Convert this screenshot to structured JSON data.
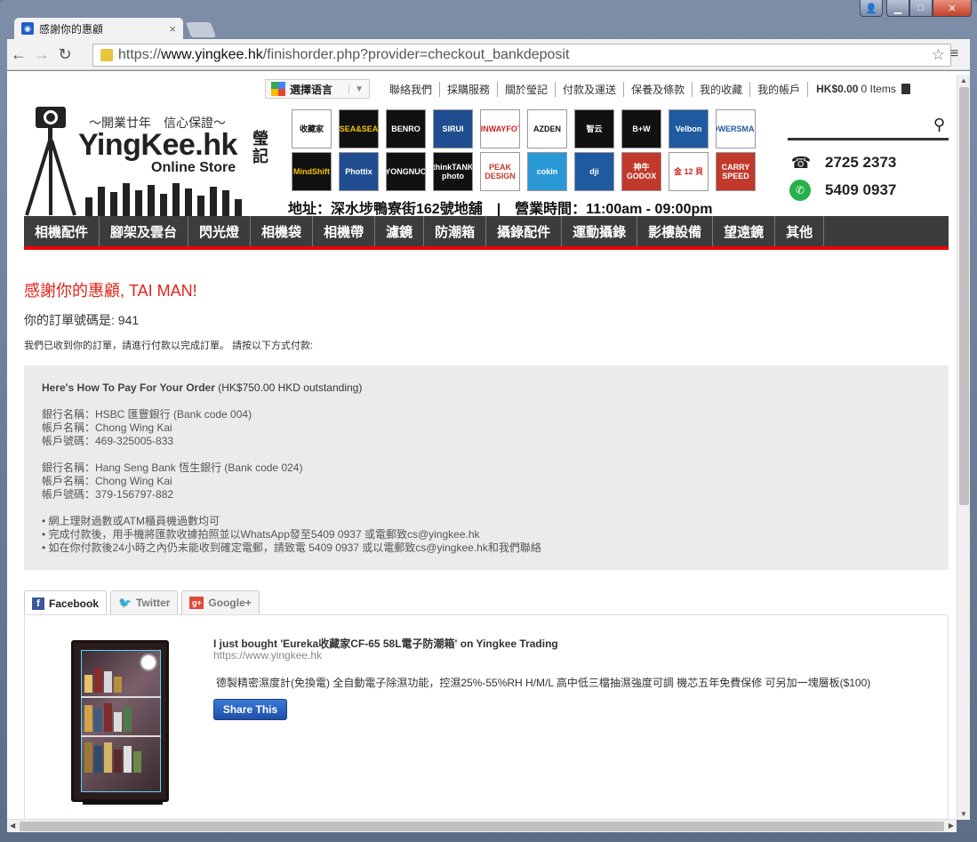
{
  "browser": {
    "tab_title": "感謝你的惠顧",
    "url_scheme": "https://",
    "url_host": "www.yingkee.hk",
    "url_path": "/finishorder.php?provider=checkout_bankdeposit"
  },
  "header": {
    "language_label": "選擇语言",
    "links": [
      "聯絡我們",
      "採購服務",
      "關於瑩記",
      "付款及運送",
      "保養及條款",
      "我的收藏",
      "我的帳戶"
    ],
    "cart_amount": "HK$0.00",
    "cart_items": "0 Items"
  },
  "logo": {
    "slogan": "～開業廿年　信心保證～",
    "name": "YingKee.hk",
    "store": "Online Store",
    "chinese": "瑩記"
  },
  "brands": [
    {
      "label": "收藏家",
      "bg": "#ffffff",
      "fg": "#111111"
    },
    {
      "label": "SEA&SEA",
      "bg": "#111111",
      "fg": "#f2c200"
    },
    {
      "label": "BENRO",
      "bg": "#111111",
      "fg": "#ffffff"
    },
    {
      "label": "SIRUI",
      "bg": "#1f4d8f",
      "fg": "#ffffff"
    },
    {
      "label": "SUNWAYFOTO",
      "bg": "#ffffff",
      "fg": "#d22222"
    },
    {
      "label": "AZDEN",
      "bg": "#ffffff",
      "fg": "#111111"
    },
    {
      "label": "智云",
      "bg": "#111111",
      "fg": "#ffffff"
    },
    {
      "label": "B+W",
      "bg": "#111111",
      "fg": "#ffffff"
    },
    {
      "label": "Velbon",
      "bg": "#1f5aa0",
      "fg": "#ffffff"
    },
    {
      "label": "POWERSMART",
      "bg": "#ffffff",
      "fg": "#1f5aa0"
    },
    {
      "label": "MindShift",
      "bg": "#111111",
      "fg": "#f2c200"
    },
    {
      "label": "Phottix",
      "bg": "#1f4d8f",
      "fg": "#ffffff"
    },
    {
      "label": "YONGNUO",
      "bg": "#111111",
      "fg": "#ffffff"
    },
    {
      "label": "thinkTANK photo",
      "bg": "#111111",
      "fg": "#ffffff"
    },
    {
      "label": "PEAK DESIGN",
      "bg": "#ffffff",
      "fg": "#c0392b"
    },
    {
      "label": "cokin",
      "bg": "#2b98d6",
      "fg": "#ffffff"
    },
    {
      "label": "dji",
      "bg": "#1f5aa0",
      "fg": "#ffffff"
    },
    {
      "label": "神牛 GODOX",
      "bg": "#c0392b",
      "fg": "#ffffff"
    },
    {
      "label": "金 12 貝",
      "bg": "#ffffff",
      "fg": "#d22222"
    },
    {
      "label": "CARRY SPEED",
      "bg": "#c0392b",
      "fg": "#ffffff"
    }
  ],
  "address": "地址：深水埗鴨寮街162號地舖　|　營業時間：11:00am - 09:00pm",
  "contact": {
    "phone": "2725 2373",
    "whatsapp": "5409 0937"
  },
  "categories": [
    "相機配件",
    "腳架及雲台",
    "閃光燈",
    "相機袋",
    "相機帶",
    "濾鏡",
    "防潮箱",
    "攝錄配件",
    "運動攝錄",
    "影樓設備",
    "望遠鏡",
    "其他"
  ],
  "main": {
    "thanks": "感謝你的惠顧, TAI MAN!",
    "order_number": "你的訂單號碼是: 941",
    "received": "我們已收到你的訂單，請進行付款以完成訂單。 請按以下方式付款:",
    "howto_bold": "Here's How To Pay For Your Order",
    "howto_amount": " (HK$750.00 HKD outstanding)",
    "bank1": [
      "銀行名稱：HSBC 匯豐銀行 (Bank code 004)",
      "帳戶名稱：Chong Wing Kai",
      "帳戶號碼：469-325005-833"
    ],
    "bank2": [
      "銀行名稱：Hang Seng Bank 恆生銀行 (Bank code 024)",
      "帳戶名稱：Chong Wing Kai",
      "帳戶號碼：379-156797-882"
    ],
    "notes": [
      "• 網上理財過數或ATM櫃員機過數均可",
      "• 完成付款後，用手機將匯款收據拍照並以WhatsApp發至5409 0937 或電郵致cs@yingkee.hk",
      "• 如在你付款後24小時之內仍未能收到確定電郵，請致電 5409 0937 或以電郵致cs@yingkee.hk和我們聯絡"
    ]
  },
  "share": {
    "tabs": [
      "Facebook",
      "Twitter",
      "Google+"
    ],
    "title": "I just bought 'Eureka收藏家CF-65 58L電子防潮箱' on Yingkee Trading",
    "url": "https://www.yingkee.hk",
    "desc": "德製精密濕度計(免換電) 全自動電子除濕功能，控濕25%-55%RH H/M/L 高中低三檔抽濕強度可調 機芯五年免費保修 可另加一塊層板($100)",
    "button": "Share This"
  }
}
